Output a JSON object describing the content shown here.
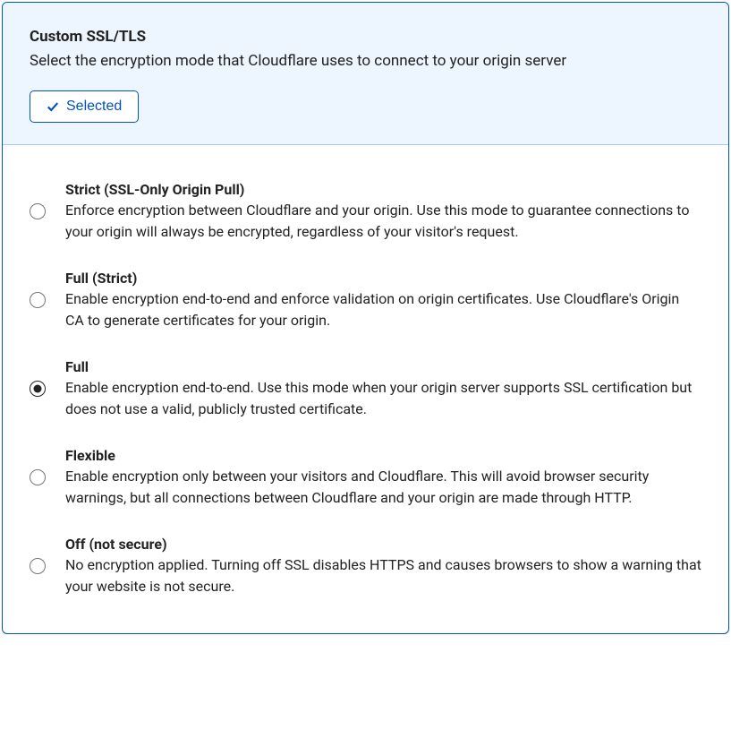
{
  "header": {
    "title": "Custom SSL/TLS",
    "subtitle": "Select the encryption mode that Cloudflare uses to connect to your origin server",
    "selected_label": "Selected"
  },
  "options": [
    {
      "title": "Strict (SSL-Only Origin Pull)",
      "desc": "Enforce encryption between Cloudflare and your origin. Use this mode to guarantee connections to your origin will always be encrypted, regardless of your visitor's request.",
      "selected": false
    },
    {
      "title": "Full (Strict)",
      "desc": "Enable encryption end-to-end and enforce validation on origin certificates. Use Cloudflare's Origin CA to generate certificates for your origin.",
      "selected": false
    },
    {
      "title": "Full",
      "desc": "Enable encryption end-to-end. Use this mode when your origin server supports SSL certification but does not use a valid, publicly trusted certificate.",
      "selected": true
    },
    {
      "title": "Flexible",
      "desc": "Enable encryption only between your visitors and Cloudflare. This will avoid browser security warnings, but all connections between Cloudflare and your origin are made through HTTP.",
      "selected": false
    },
    {
      "title": "Off (not secure)",
      "desc": "No encryption applied. Turning off SSL disables HTTPS and causes browsers to show a warning that your website is not secure.",
      "selected": false
    }
  ]
}
